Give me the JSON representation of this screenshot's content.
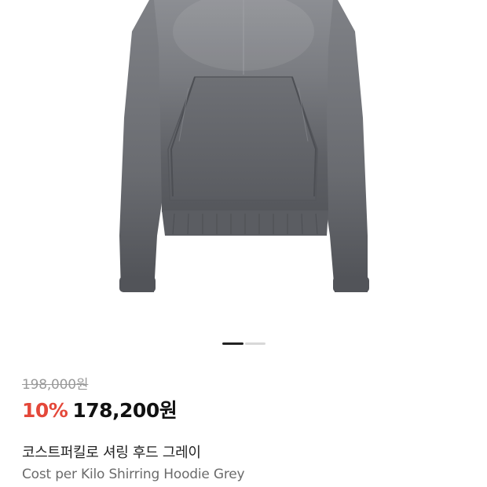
{
  "product": {
    "image_alt": "grey shirring hoodie photo",
    "original_price": "198,000원",
    "discount": "10%",
    "sale_price": "178,200원",
    "name_ko": "코스트퍼킬로 셔링 후드 그레이",
    "name_en": "Cost per Kilo Shirring Hoodie Grey"
  },
  "carousel": {
    "total_pages": 2,
    "active_page": 1
  },
  "colors": {
    "discount": "#e4483a",
    "price": "#111111",
    "strike": "#9a9a9a",
    "subtitle": "#6b6b6b",
    "garment": "#6d6f74"
  }
}
